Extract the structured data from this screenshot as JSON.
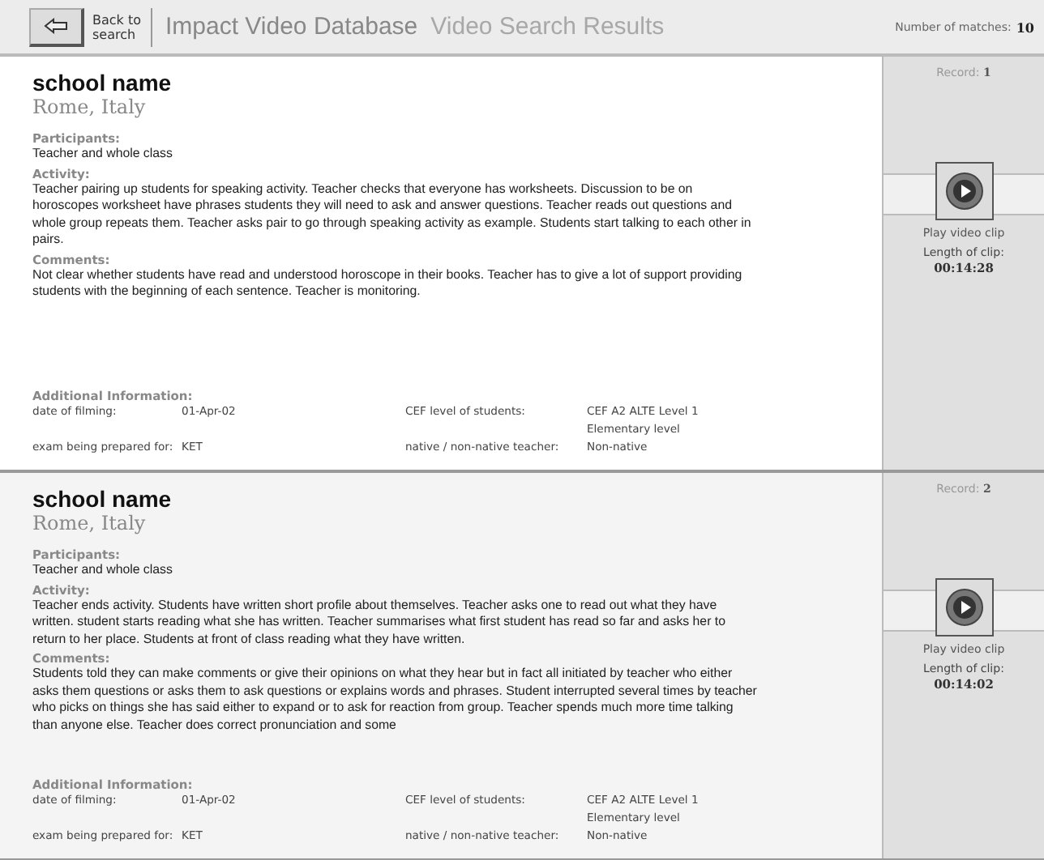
{
  "header": {
    "back_button": {
      "label": "Back to search"
    },
    "app_title": "Impact Video Database",
    "page_title": "Video Search Results",
    "matches_label": "Number of matches:",
    "matches_count": "10"
  },
  "records": [
    {
      "school": "school name",
      "location": "Rome, Italy",
      "participants_label": "Participants:",
      "participants": "Teacher and whole class",
      "activity_label": "Activity:",
      "activity": "Teacher pairing up students for speaking activity.  Teacher checks that everyone has worksheets.  Discussion to be on horoscopes worksheet have phrases students they will need to ask and answer questions.  Teacher reads out questions and whole group repeats them.  Teacher asks pair to go through speaking activity as example.  Students start talking to each other in pairs.",
      "comments_label": "Comments:",
      "comments": "Not clear whether students have read and understood horoscope in their books.  Teacher has to give a lot of support providing students with the beginning of each sentence.  Teacher is monitoring.",
      "additional_label": "Additional Information:",
      "info": [
        {
          "label": "date of filming:",
          "value": "01-Apr-02"
        },
        {
          "label": "CEF level of students:",
          "value": "CEF A2 ALTE Level 1 Elementary level"
        },
        {
          "label": "exam being prepared for:",
          "value": "KET"
        },
        {
          "label": "native / non-native teacher:",
          "value": "Non-native"
        }
      ],
      "record_label": "Record:",
      "record_number": "1",
      "play_label": "Play video clip",
      "length_label": "Length of clip:",
      "length": "00:14:28",
      "selected": false
    },
    {
      "school": "school name",
      "location": "Rome, Italy",
      "participants_label": "Participants:",
      "participants": "Teacher and whole class",
      "activity_label": "Activity:",
      "activity": "Teacher ends activity.  Students have written short profile about themselves. Teacher asks one to read out what they have written.  student starts reading what she has written.  Teacher summarises what first student has read so far and asks her to return to her place.  Students at front of class reading what they have written.",
      "comments_label": "Comments:",
      "comments": "Students told they can make comments or give their opinions on what they hear but in fact all initiated by teacher who either asks them questions or asks them to ask questions or explains words and phrases.  Student interrupted several times by teacher who picks on things she has said either to expand or to ask for reaction from group.  Teacher spends much more time talking than anyone else.  Teacher does correct pronunciation and some",
      "additional_label": "Additional Information:",
      "info": [
        {
          "label": "date of filming:",
          "value": "01-Apr-02"
        },
        {
          "label": "CEF level of students:",
          "value": "CEF A2 ALTE Level 1 Elementary level"
        },
        {
          "label": "exam being prepared for:",
          "value": "KET"
        },
        {
          "label": "native / non-native teacher:",
          "value": "Non-native"
        }
      ],
      "record_label": "Record:",
      "record_number": "2",
      "play_label": "Play video clip",
      "length_label": "Length of clip:",
      "length": "00:14:02",
      "selected": true
    }
  ]
}
